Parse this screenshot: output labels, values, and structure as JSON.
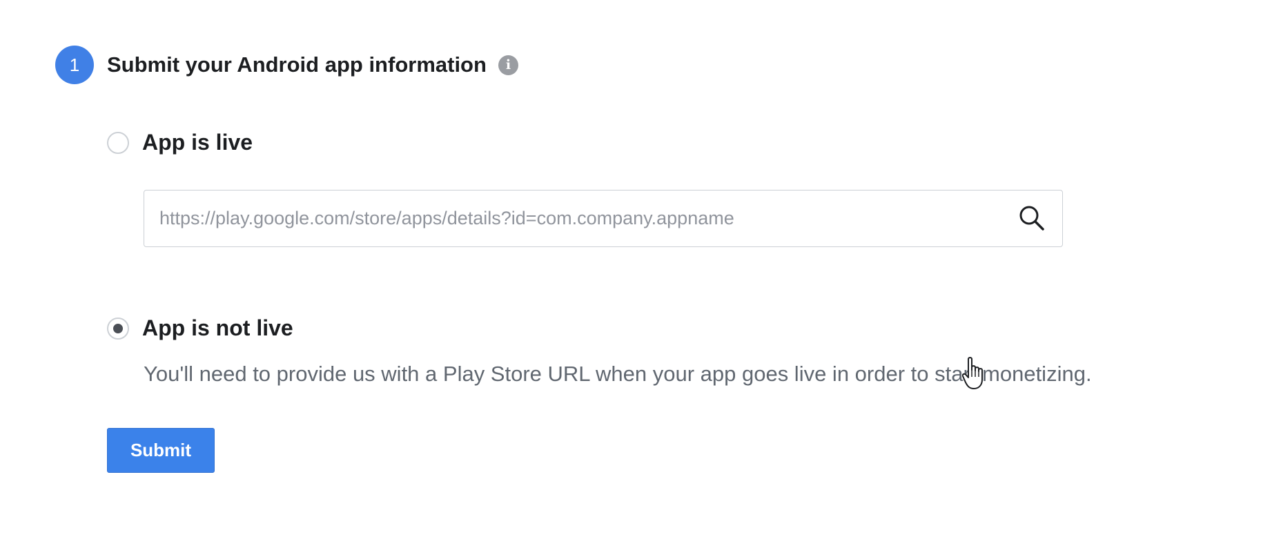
{
  "step": {
    "number": "1",
    "title": "Submit your Android app information",
    "info_icon": "info-icon"
  },
  "options": {
    "live": {
      "label": "App is live",
      "selected": false,
      "url_input": {
        "value": "",
        "placeholder": "https://play.google.com/store/apps/details?id=com.company.appname",
        "icon": "search-icon"
      }
    },
    "not_live": {
      "label": "App is not live",
      "selected": true,
      "helper_text": "You'll need to provide us with a Play Store URL when your app goes live in order to start monetizing."
    }
  },
  "actions": {
    "submit_label": "Submit"
  },
  "colors": {
    "accent": "#4080e6",
    "button": "#3b82ea",
    "text": "#1c1e21",
    "muted_text": "#606770",
    "border": "#ccd0d5",
    "placeholder": "#90949c",
    "info_icon": "#9a9da2"
  },
  "cursor": "hand-pointer"
}
